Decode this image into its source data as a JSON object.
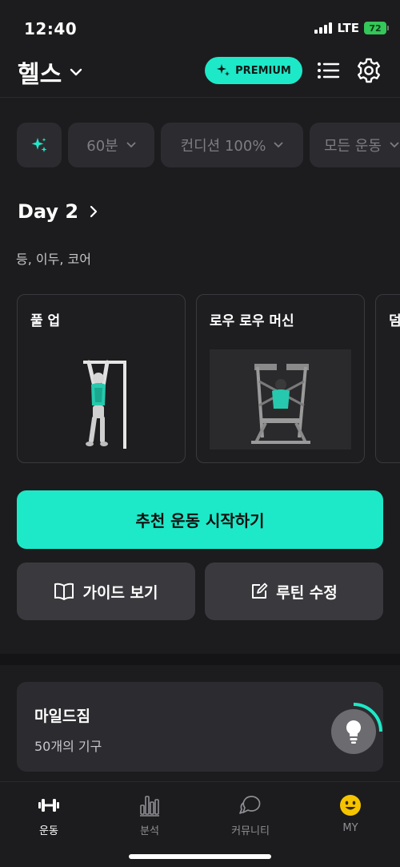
{
  "status_bar": {
    "time": "12:40",
    "network": "LTE",
    "battery": "72"
  },
  "header": {
    "title": "헬스",
    "premium_label": "PREMIUM"
  },
  "filters": [
    {
      "label": "60분"
    },
    {
      "label": "컨디션 100%"
    },
    {
      "label": "모든 운동"
    }
  ],
  "day": {
    "title": "Day 2",
    "muscles": "등, 이두, 코어"
  },
  "exercises": [
    {
      "name": "풀 업"
    },
    {
      "name": "로우 로우 머신"
    },
    {
      "name": "덤"
    }
  ],
  "actions": {
    "start_label": "추천 운동 시작하기",
    "guide_label": "가이드 보기",
    "edit_label": "루틴 수정"
  },
  "gym": {
    "name": "마일드짐",
    "equipment_count": "50개의 기구"
  },
  "tabs": [
    {
      "label": "운동",
      "active": true
    },
    {
      "label": "분석",
      "active": false
    },
    {
      "label": "커뮤니티",
      "active": false
    },
    {
      "label": "MY",
      "active": false
    }
  ],
  "colors": {
    "accent": "#1de9c8",
    "background": "#1c1c1e",
    "surface": "#2c2c30",
    "battery": "#34c759",
    "my_emoji": "#f5c400"
  }
}
